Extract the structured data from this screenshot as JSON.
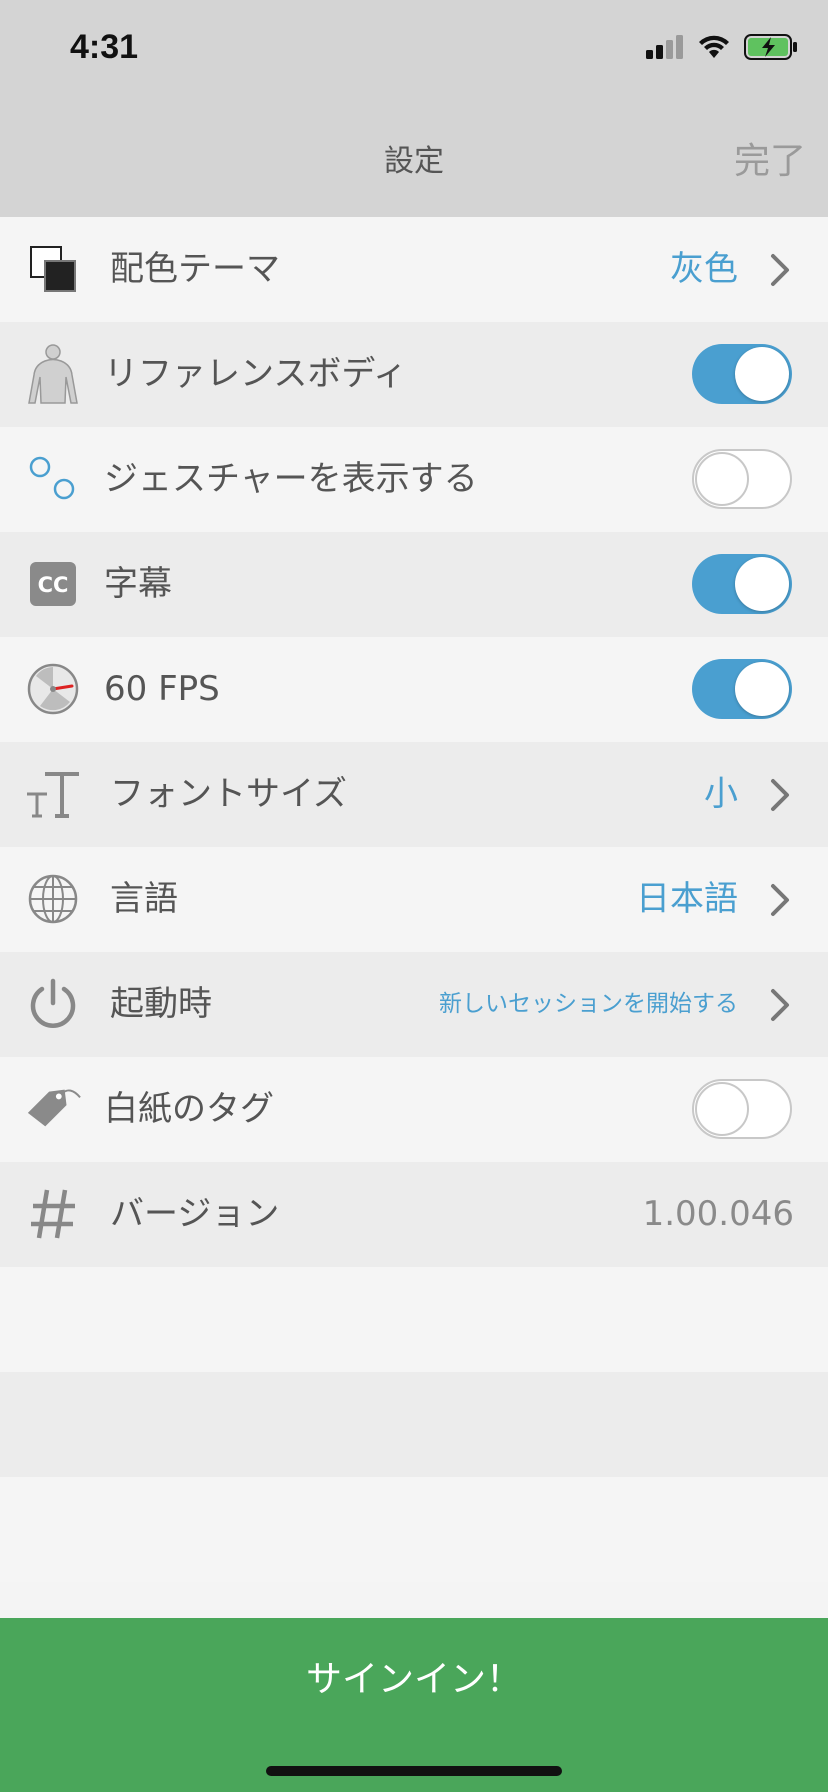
{
  "status_bar": {
    "time": "4:31"
  },
  "nav": {
    "title": "設定",
    "done_label": "完了"
  },
  "rows": [
    {
      "label": "配色テーマ",
      "value": "灰色",
      "icon": "color-theme-icon"
    },
    {
      "label": "リファレンスボディ",
      "toggle": "on",
      "icon": "body-icon"
    },
    {
      "label": "ジェスチャーを表示する",
      "toggle": "off",
      "icon": "gesture-icon"
    },
    {
      "label": "字幕",
      "toggle": "on",
      "icon": "cc-icon",
      "icon_text": "CC"
    },
    {
      "label": "60 FPS",
      "toggle": "on",
      "icon": "speedometer-icon"
    },
    {
      "label": "フォントサイズ",
      "value": "小",
      "icon": "font-size-icon"
    },
    {
      "label": "言語",
      "value": "日本語",
      "icon": "globe-icon"
    },
    {
      "label": "起動時",
      "value": "新しいセッションを開始する",
      "icon": "power-icon"
    },
    {
      "label": "白紙のタグ",
      "toggle": "off",
      "icon": "tag-icon"
    },
    {
      "label": "バージョン",
      "value": "1.00.046",
      "icon": "hash-icon"
    }
  ],
  "signin": {
    "label": "サインイン！"
  },
  "colors": {
    "accent": "#4a9fd0",
    "signin_bg": "#4aa65a",
    "header_bg": "#d4d4d4"
  }
}
